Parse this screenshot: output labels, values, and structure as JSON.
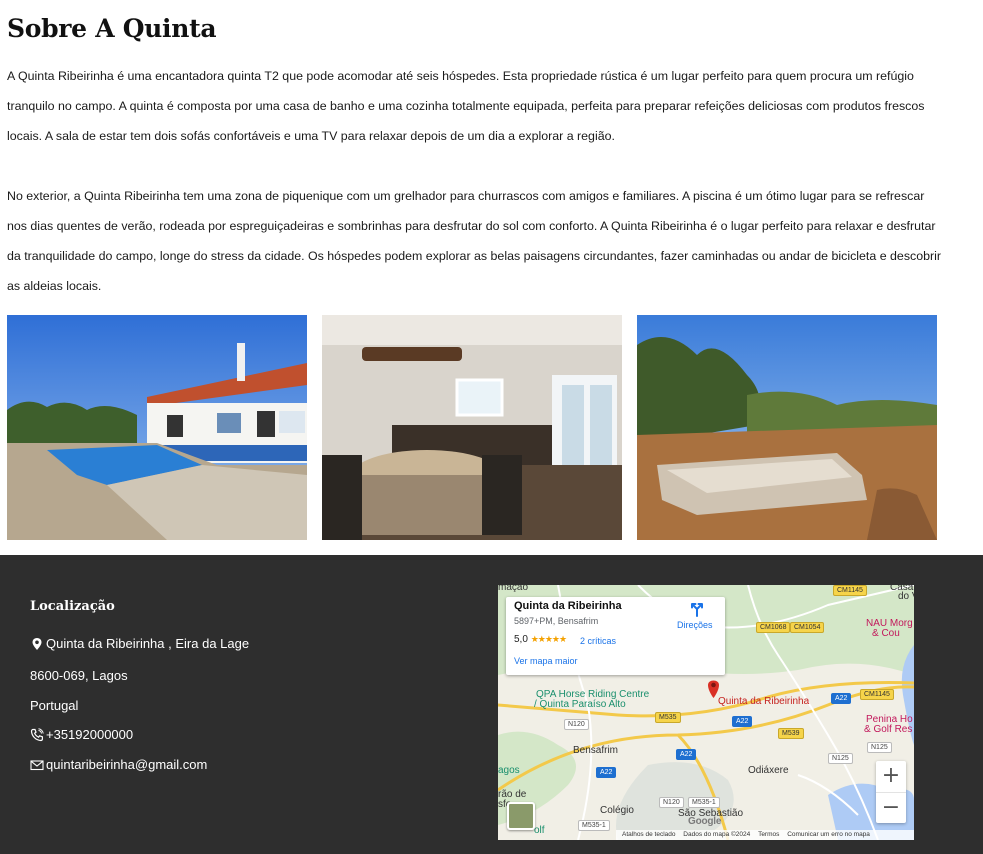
{
  "about": {
    "title": "Sobre A Quinta",
    "paragraph1": "A Quinta Ribeirinha é uma encantadora quinta T2 que pode acomodar até seis hóspedes. Esta propriedade rústica é um lugar perfeito para quem procura um refúgio tranquilo no campo. A quinta é composta por uma casa de banho e uma cozinha totalmente equipada, perfeita para preparar refeições deliciosas com produtos frescos locais. A sala de estar tem dois sofás confortáveis e uma TV para relaxar depois de um dia a explorar a região.",
    "paragraph2": "No exterior, a Quinta Ribeirinha tem uma zona de piquenique com um grelhador para churrascos com amigos e familiares. A piscina é um ótimo lugar para se refrescar nos dias quentes de verão, rodeada por espreguiçadeiras e sombrinhas para desfrutar do sol com conforto. A Quinta Ribeirinha é o lugar perfeito para relaxar e desfrutar da tranquilidade do campo, longe do stress da cidade. Os hóspedes podem explorar as belas paisagens circundantes, fazer caminhadas ou andar de bicicleta e descobrir as aldeias locais."
  },
  "photos": [
    {
      "subject": "house-with-pool-photo"
    },
    {
      "subject": "kitchen-dining-photo"
    },
    {
      "subject": "garden-stone-planter-photo"
    }
  ],
  "footer": {
    "title": "Localização",
    "address_line1": "Quinta da Ribeirinha , Eira da Lage",
    "address_line2": "8600-069, Lagos",
    "country": "Portugal",
    "phone": "+35192000000",
    "email": "quintaribeirinha@gmail.com",
    "icons": {
      "location": "map-pin-icon",
      "phone": "phone-icon",
      "email": "envelope-icon"
    }
  },
  "map": {
    "place_name": "Quinta da Ribeirinha",
    "plus_code": "5897+PM, Bensafrim",
    "rating": "5,0",
    "stars": "★★★★★",
    "reviews": "2 críticas",
    "larger_map": "Ver mapa maior",
    "directions": "Direções",
    "marker_label": "Quinta da Ribeirinha",
    "labels": {
      "qpa1": "QPA Horse Riding Centre",
      "qpa2": "/ Quinta Paraíso Alto",
      "bensafrim": "Bensafrim",
      "odiaxere": "Odiáxere",
      "sao_sebastiao": "São Sebastião",
      "colegio": "Colégio",
      "nau1": "NAU Morg",
      "nau2": "& Cou",
      "penina1": "Penina Ho",
      "penina2": "& Golf Res",
      "top_left": "maçao",
      "top_right": "Casa",
      "top_right2": "do V",
      "lagos": "agos",
      "rao": "rão de",
      "sfo": "sfo",
      "golf": "olf"
    },
    "roads": [
      "CM1145",
      "CM1068",
      "CM1054",
      "A22",
      "CM1145",
      "M535",
      "N120",
      "A22",
      "M539",
      "N125",
      "N125",
      "A22",
      "A22",
      "N120",
      "M535-1",
      "M535-1"
    ],
    "zoom_in": "+",
    "zoom_out": "−",
    "google": "Google",
    "attribution": {
      "shortcuts": "Atalhos de teclado",
      "data": "Dados do mapa ©2024",
      "terms": "Termos",
      "report": "Comunicar um erro no mapa"
    },
    "colors": {
      "marker": "#d93025",
      "link": "#1a73e8",
      "highway": "#f6d44a",
      "water": "#8ab4f8"
    }
  }
}
